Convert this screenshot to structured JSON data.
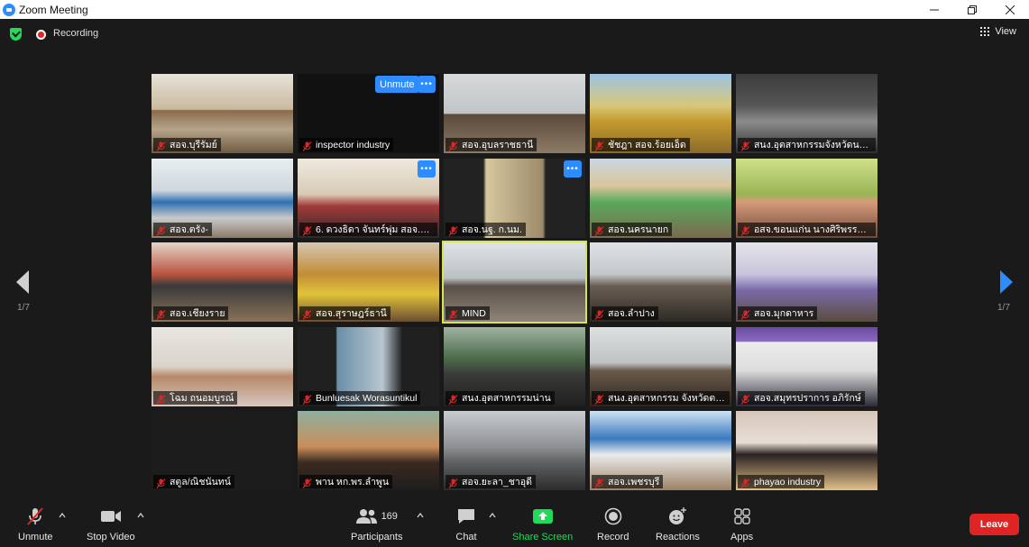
{
  "window": {
    "title": "Zoom Meeting"
  },
  "topbar": {
    "recording_label": "Recording",
    "view_label": "View"
  },
  "pagination": {
    "left": "1/7",
    "right": "1/7"
  },
  "tiles": [
    {
      "name": "สอจ.บุรีรัมย์",
      "scene": "a",
      "active": false
    },
    {
      "name": "inspector industry",
      "scene": "dark",
      "active": false,
      "unmute_label": "Unmute",
      "more": true
    },
    {
      "name": "สอจ.อุบลราชธานี",
      "scene": "b",
      "active": false
    },
    {
      "name": "ชัชฎา สอจ.ร้อยเอ็ด",
      "scene": "c",
      "active": false
    },
    {
      "name": "สนง.อุตสาหกรรมจังหวัดนครส...",
      "scene": "d",
      "active": false
    },
    {
      "name": "สอจ.ตรัง-",
      "scene": "e",
      "active": false
    },
    {
      "name": "6. ดวงธิดา จันทร์พุ่ม สอจ.พัทลุง",
      "scene": "f",
      "active": false,
      "more": true
    },
    {
      "name": "สอจ.นฐ. ก.นม.",
      "scene": "g",
      "active": false,
      "more": true
    },
    {
      "name": "สอจ.นครนายก",
      "scene": "h",
      "active": false
    },
    {
      "name": "อสจ.ขอนแก่น นางศิริพรรณ อิ...",
      "scene": "i",
      "active": false
    },
    {
      "name": "สอจ.เชียงราย",
      "scene": "j",
      "active": false
    },
    {
      "name": "สอจ.สุราษฎร์ธานี",
      "scene": "k",
      "active": false
    },
    {
      "name": "MIND",
      "scene": "l",
      "active": true
    },
    {
      "name": "สอจ.ลำปาง",
      "scene": "m",
      "active": false
    },
    {
      "name": "สอจ.มุกดาหาร",
      "scene": "n",
      "active": false
    },
    {
      "name": "โฉม ถนอมบูรณ์",
      "scene": "o",
      "active": false
    },
    {
      "name": "Bunluesak Worasuntikul",
      "scene": "p",
      "active": false
    },
    {
      "name": "สนง.อุตสาหกรรมน่าน",
      "scene": "q",
      "active": false
    },
    {
      "name": "สนง.อุตสาหกรรม จังหวัดตาก",
      "scene": "r",
      "active": false
    },
    {
      "name": "สอจ.สมุทรปราการ อภิรักษ์",
      "scene": "s",
      "active": false
    },
    {
      "name": "สตูล/ณิชนันทน์",
      "scene": "t",
      "active": false
    },
    {
      "name": "พาน หก.พร.ลำพูน",
      "scene": "u",
      "active": false
    },
    {
      "name": "สอจ.ยะลา_ชาอุดี",
      "scene": "v",
      "active": false
    },
    {
      "name": "สอจ.เพชรบุรี",
      "scene": "w",
      "active": false
    },
    {
      "name": "phayao industry",
      "scene": "x",
      "active": false
    }
  ],
  "toolbar": {
    "unmute": "Unmute",
    "stop_video": "Stop Video",
    "participants": "Participants",
    "participant_count": "169",
    "chat": "Chat",
    "share_screen": "Share Screen",
    "record": "Record",
    "reactions": "Reactions",
    "apps": "Apps",
    "leave": "Leave"
  },
  "colors": {
    "accent": "#2d8cff",
    "share": "#23d959",
    "leave": "#e02424",
    "active_speaker": "#d4e64a"
  }
}
